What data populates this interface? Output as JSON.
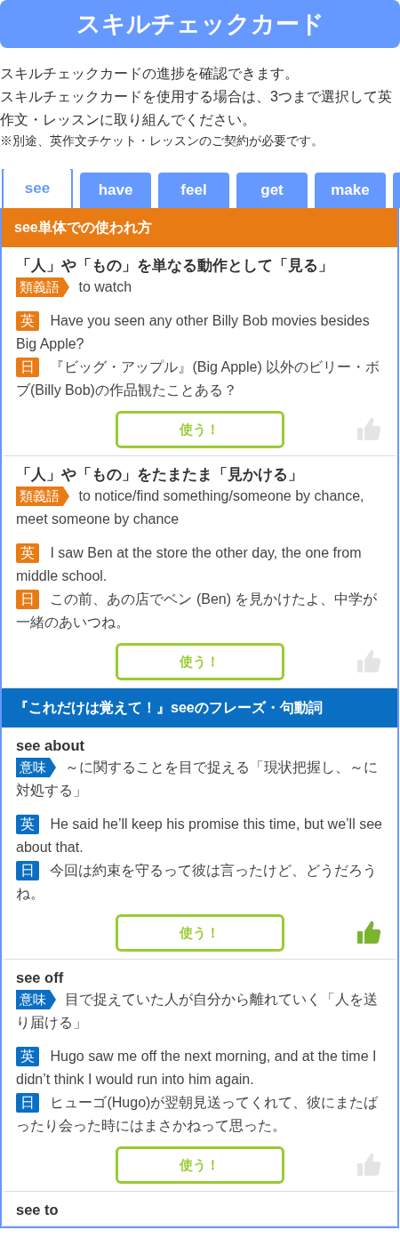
{
  "header": {
    "title": "スキルチェックカード"
  },
  "intro": {
    "lines": [
      "スキルチェックカードの進捗を確認できます。",
      "スキルチェックカードを使用する場合は、3つまで選択して英作文・レッスンに取り組んでください。"
    ],
    "note": "※別途、英作文チケット・レッスンのご契約が必要です。"
  },
  "tabs": [
    {
      "label": "see",
      "selected": true
    },
    {
      "label": "have",
      "selected": false
    },
    {
      "label": "feel",
      "selected": false
    },
    {
      "label": "get",
      "selected": false
    },
    {
      "label": "make",
      "selected": false
    }
  ],
  "sections": [
    {
      "kind": "usage",
      "title": "see単体での使われ方",
      "entries": [
        {
          "title": "「人」や「もの」を単なる動作として「見る」",
          "tag": "類義語",
          "meaning": "to watch",
          "en_label": "英",
          "en": "Have you seen any other Billy Bob movies besides Big Apple?",
          "ja_label": "日",
          "ja": "『ビッグ・アップル』(Big Apple) 以外のビリー・ボブ(Billy Bob)の作品観たことある？",
          "button": "使う！",
          "liked": false
        },
        {
          "title": "「人」や「もの」をたまたま「見かける」",
          "tag": "類義語",
          "meaning": "to notice/find something/someone by chance, meet someone by chance",
          "en_label": "英",
          "en": "I saw Ben at the store the other day, the one from middle school.",
          "ja_label": "日",
          "ja": "この前、あの店でベン (Ben) を見かけたよ、中学が一緒のあいつね。",
          "button": "使う！",
          "liked": false
        }
      ]
    },
    {
      "kind": "phrase",
      "title": "『これだけは覚えて！』seeのフレーズ・句動詞",
      "entries": [
        {
          "title": "see about",
          "tag": "意味",
          "meaning": "～に関することを目で捉える「現状把握し、～に対処する」",
          "en_label": "英",
          "en": "He said he’ll keep his promise this time, but we’ll see about that.",
          "ja_label": "日",
          "ja": "今回は約束を守るって彼は言ったけど、どうだろうね。",
          "button": "使う！",
          "liked": true
        },
        {
          "title": "see off",
          "tag": "意味",
          "meaning": "目で捉えていた人が自分から離れていく「人を送り届ける」",
          "en_label": "英",
          "en": "Hugo saw me off the next morning, and at the time I didn’t think I would run into him again.",
          "ja_label": "日",
          "ja": "ヒューゴ(Hugo)が翌朝見送ってくれて、彼にまたばったり会った時にはまさかねって思った。",
          "button": "使う！",
          "liked": false
        },
        {
          "title": "see to"
        }
      ]
    }
  ]
}
